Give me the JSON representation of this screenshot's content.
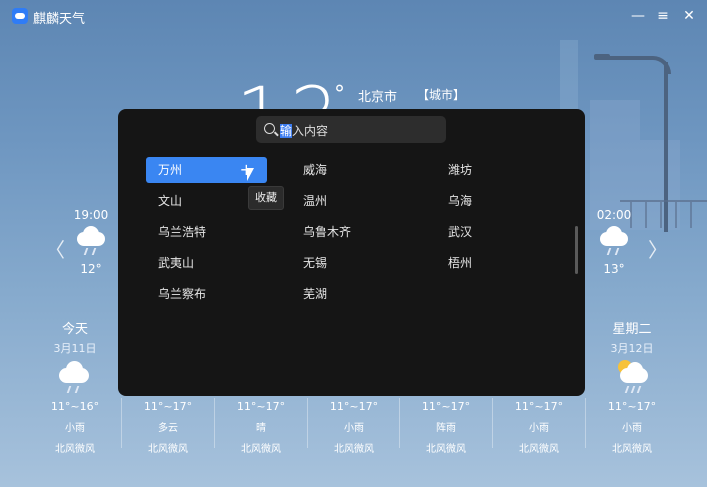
{
  "app": {
    "title": "麒麟天气"
  },
  "window_controls": {
    "minimize": "—",
    "menu": "≡",
    "close": "✕"
  },
  "current": {
    "temp": "12",
    "deg": "°",
    "city": "北京市",
    "city_tag": "【城市】"
  },
  "nav": {
    "left": "〈",
    "right": "〉"
  },
  "hourly": [
    {
      "time": "19:00",
      "temp": "12°",
      "icon": "rain-cloud-icon"
    },
    {
      "time": "02:00",
      "temp": "13°",
      "icon": "rain-cloud-icon"
    }
  ],
  "days": [
    {
      "name": "今天",
      "date": "3月11日",
      "range": "11°~16°",
      "cond": "小雨",
      "wind": "北风微风",
      "icon": "rain-cloud-icon"
    },
    {
      "name": "",
      "date": "",
      "range": "11°~17°",
      "cond": "多云",
      "wind": "北风微风"
    },
    {
      "name": "",
      "date": "",
      "range": "11°~17°",
      "cond": "晴",
      "wind": "北风微风"
    },
    {
      "name": "",
      "date": "",
      "range": "11°~17°",
      "cond": "小雨",
      "wind": "北风微风"
    },
    {
      "name": "",
      "date": "",
      "range": "11°~17°",
      "cond": "阵雨",
      "wind": "北风微风"
    },
    {
      "name": "",
      "date": "",
      "range": "11°~17°",
      "cond": "小雨",
      "wind": "北风微风"
    },
    {
      "name": "星期二",
      "date": "3月12日",
      "range": "11°~17°",
      "cond": "小雨",
      "wind": "北风微风",
      "icon": "sun-rain-cloud-icon"
    }
  ],
  "search": {
    "caret_char": "输",
    "placeholder_rest": "入内容"
  },
  "cities": {
    "col1": [
      "万州",
      "文山",
      "乌兰浩特",
      "武夷山",
      "乌兰察布"
    ],
    "col2": [
      "威海",
      "温州",
      "乌鲁木齐",
      "无锡",
      "芜湖"
    ],
    "col3": [
      "潍坊",
      "乌海",
      "武汉",
      "梧州"
    ]
  },
  "add_glyph": "+",
  "tooltip": "收藏",
  "colors": {
    "accent": "#3a86f2",
    "overlay_bg": "#151515"
  }
}
